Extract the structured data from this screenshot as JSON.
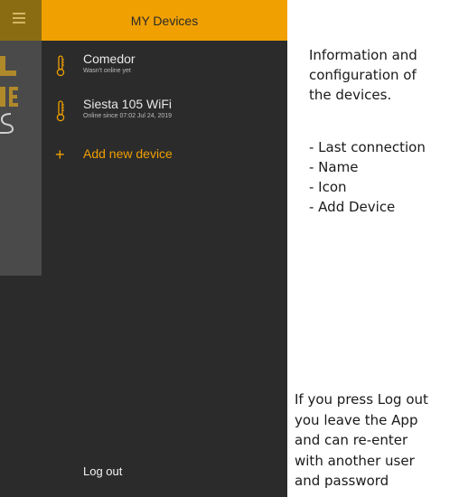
{
  "drawer": {
    "title": "MY Devices",
    "devices": [
      {
        "name": "Comedor",
        "status": "Wasn't online yet",
        "icon": "thermometer-icon"
      },
      {
        "name": "Siesta 105 WiFi",
        "status": "Online since 07:02 Jul 24, 2019",
        "icon": "thermometer-icon"
      }
    ],
    "add_device_label": "Add new device",
    "add_icon": "plus-icon",
    "logout_label": "Log out"
  },
  "menu": {
    "icon": "hamburger-icon"
  },
  "annotations": {
    "intro_lines": [
      "Information and",
      "configuration of",
      "the devices."
    ],
    "list_items": [
      "- Last connection",
      "- Name",
      "- Icon",
      "- Add Device"
    ],
    "logout_lines": [
      "If you press Log out",
      "you leave the App",
      "and can re-enter",
      "with another user",
      "and password"
    ]
  },
  "colors": {
    "accent": "#f0a000",
    "drawer_bg": "#2b2b2b",
    "underlay_bg": "#4a4a4a",
    "underlay_bar": "#8a6d12"
  }
}
